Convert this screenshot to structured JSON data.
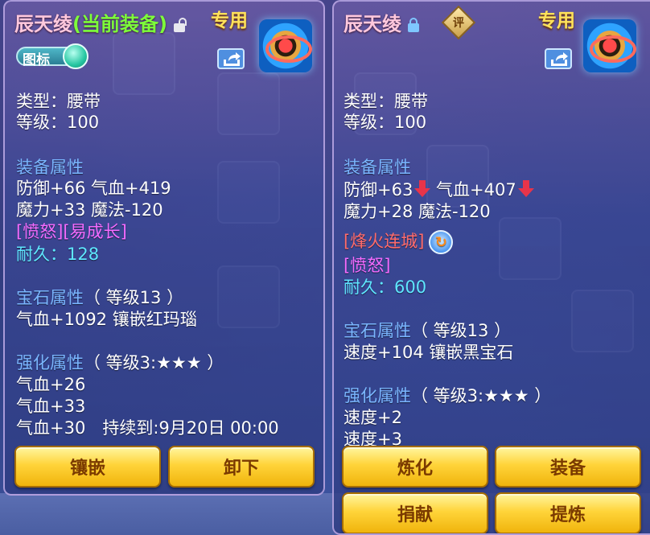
{
  "left_panel": {
    "title": "辰天绫",
    "title_status": "(当前装备)",
    "exclusive_tag": "专用",
    "icon_toggle_label": "图标",
    "type_line": "类型：腰带",
    "level_line": "等级：100",
    "equip_attr_title": "装备属性",
    "attr_line_1": "防御+66 气血+419",
    "attr_line_2": "魔力+33 魔法-120",
    "special_effects": "[愤怒][易成长]",
    "durability": "耐久：128",
    "gem_title": "宝石属性",
    "gem_level": "（ 等级13 ）",
    "gem_line": "气血+1092 镶嵌红玛瑙",
    "enhance_title": "强化属性",
    "enhance_level": "（ 等级3:★★★ ）",
    "enhance_lines": [
      "气血+26",
      "气血+33",
      "气血+30　持续到:9月20日 00:00"
    ],
    "buttons": [
      "镶嵌",
      "卸下"
    ]
  },
  "right_panel": {
    "title": "辰天绫",
    "rating_badge": "评",
    "exclusive_tag": "专用",
    "type_line": "类型：腰带",
    "level_line": "等级：100",
    "equip_attr_title": "装备属性",
    "attr_line_1a": "防御+63",
    "attr_line_1b": "气血+407",
    "attr_line_2": "魔力+28 魔法-120",
    "special_skill": "[烽火连城]",
    "special_effect": "[愤怒]",
    "durability": "耐久：600",
    "gem_title": "宝石属性",
    "gem_level": "（ 等级13 ）",
    "gem_line": "速度+104 镶嵌黑宝石",
    "enhance_title": "强化属性",
    "enhance_level": "（ 等级3:★★★ ）",
    "enhance_lines": [
      "速度+2",
      "速度+3"
    ],
    "buttons": [
      "炼化",
      "装备",
      "捐献",
      "提炼"
    ]
  },
  "colors": {
    "section_title": "#7ab6ff",
    "special": "#f46bff",
    "durability": "#5fe7ff",
    "button_gold": "#ffd43a"
  }
}
